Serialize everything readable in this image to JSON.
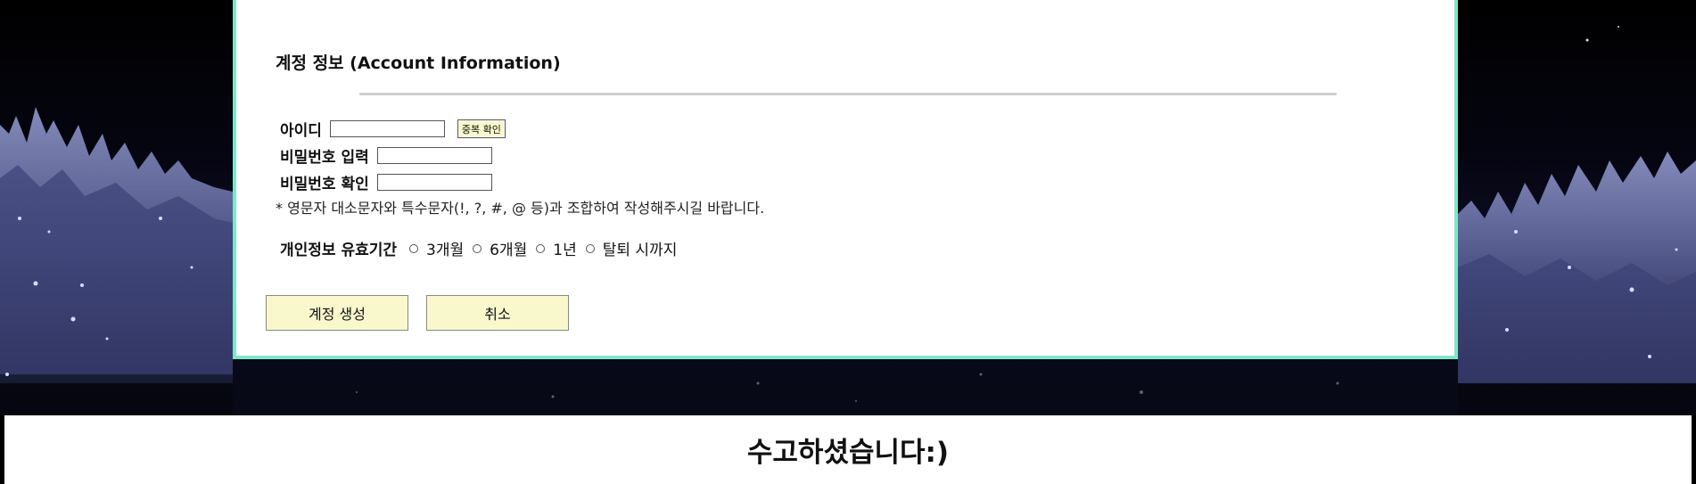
{
  "section": {
    "title": "계정 정보 (Account Information)"
  },
  "form": {
    "id_label": "아이디",
    "dup_check_label": "중복 확인",
    "password_label": "비밀번호 입력",
    "password_confirm_label": "비밀번호 확인",
    "note": "* 영문자 대소문자와 특수문자(!, ?, #, @ 등)과 조합하여 작성해주시길 바랍니다.",
    "retention": {
      "label": "개인정보 유효기간",
      "options": [
        "3개월",
        "6개월",
        "1년",
        "탈퇴 시까지"
      ]
    }
  },
  "actions": {
    "create_label": "계정 생성",
    "cancel_label": "취소"
  },
  "footer": {
    "text": "수고하셨습니다:)"
  },
  "colors": {
    "panel_border": "#7fe6c8",
    "button_bg": "#f8f8cc",
    "divider": "#cfcfcf"
  }
}
